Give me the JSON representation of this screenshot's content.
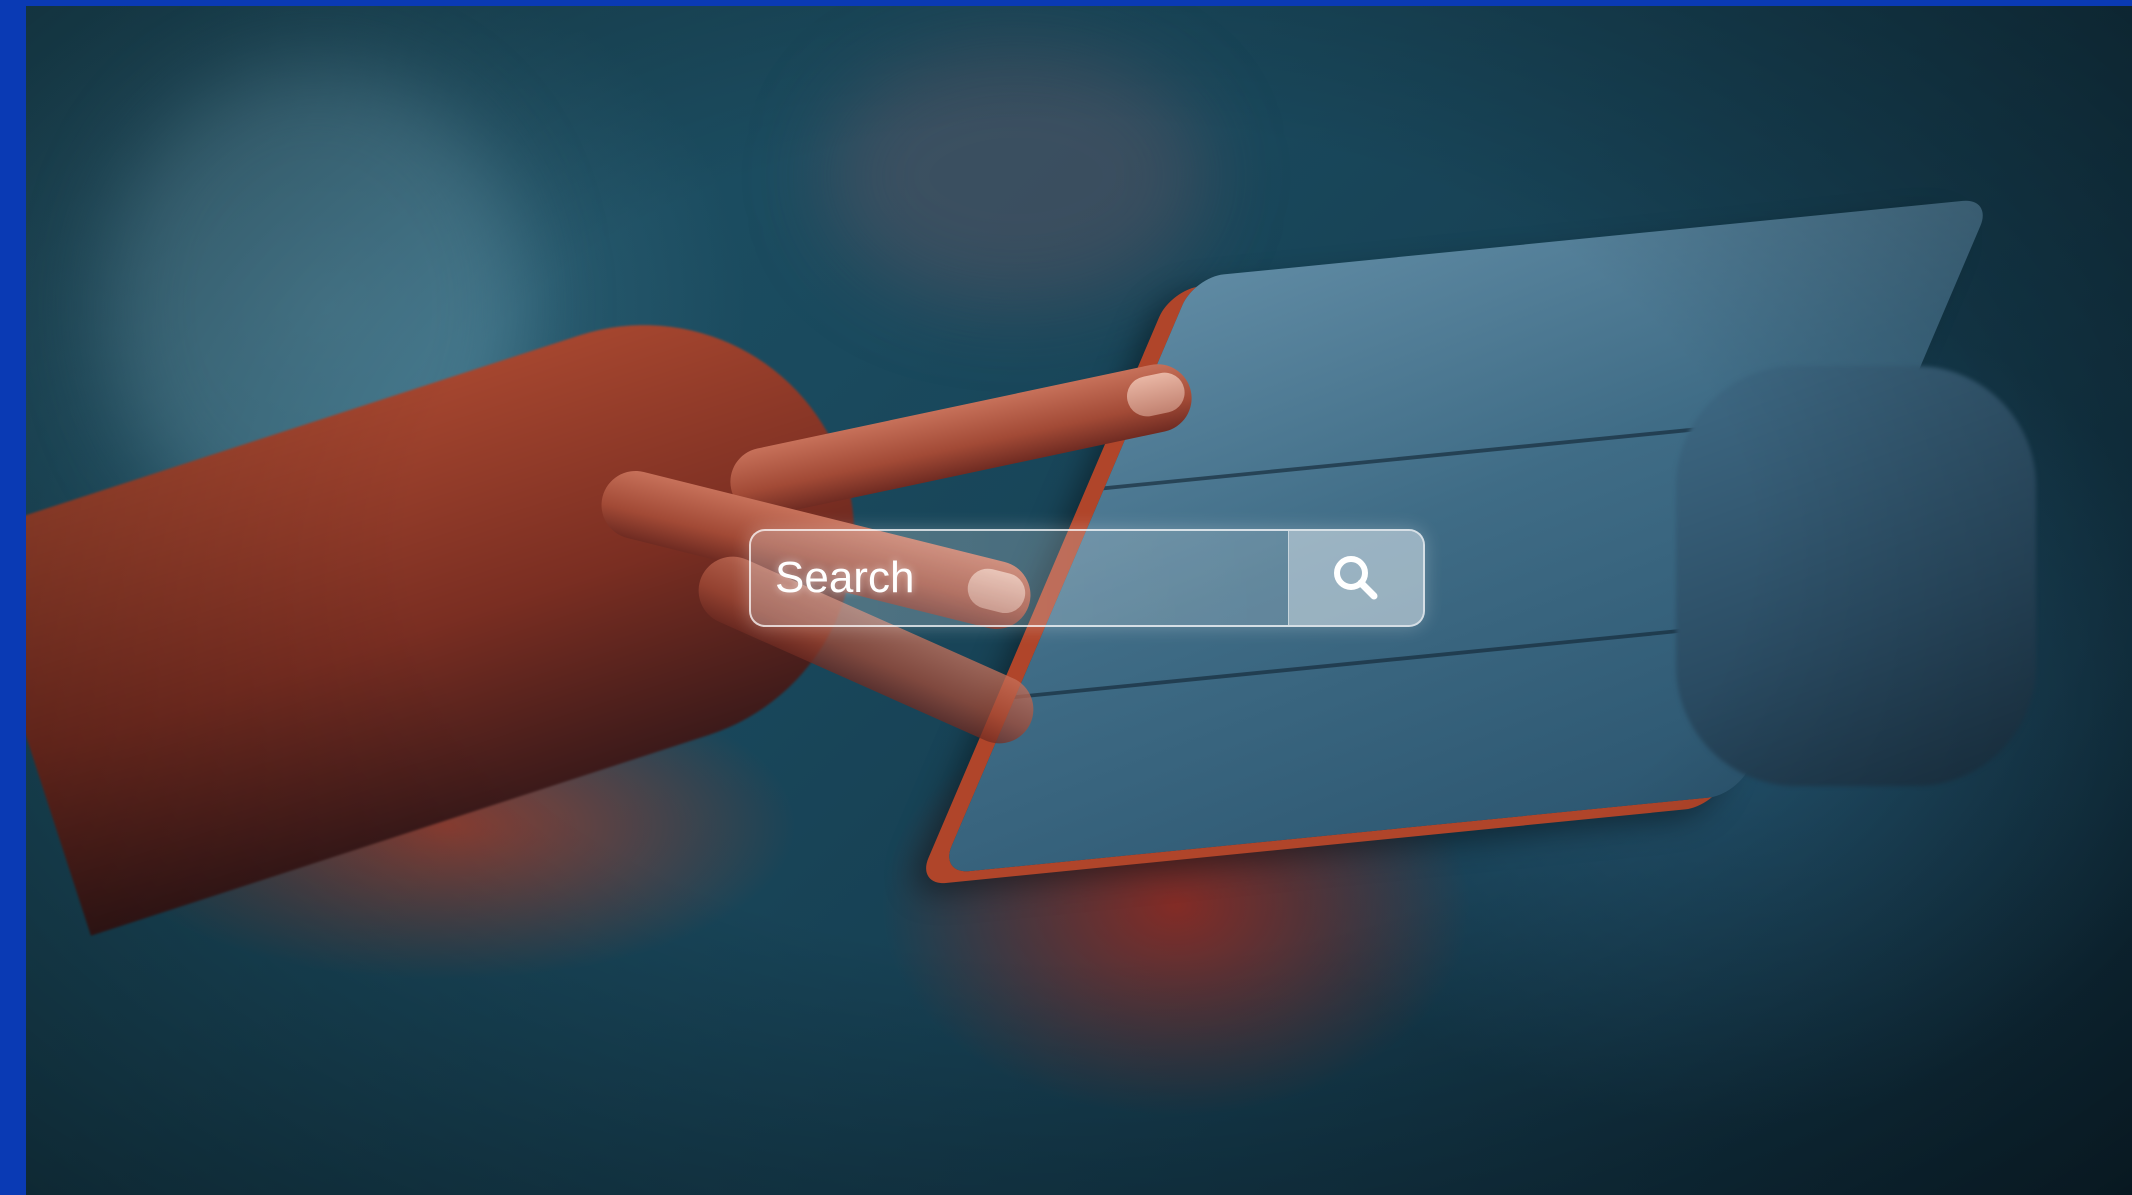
{
  "search": {
    "placeholder": "Search",
    "button_icon": "search-icon"
  },
  "colors": {
    "frame": "#0a3ab4",
    "photo_tone": "#1a4a5e",
    "search_text": "#ffffff"
  }
}
